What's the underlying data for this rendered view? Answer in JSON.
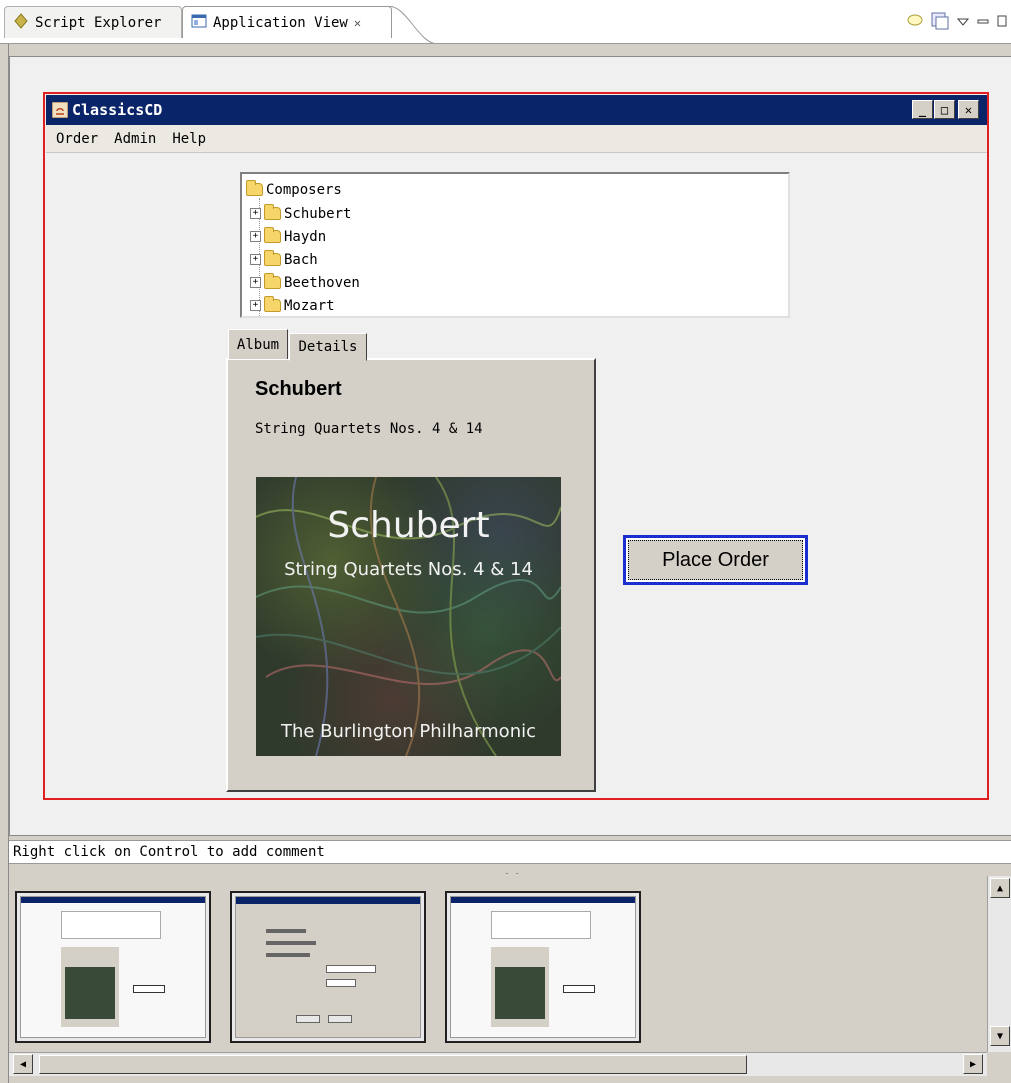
{
  "top_tabs": [
    {
      "label": "Script Explorer",
      "icon": "script-icon"
    },
    {
      "label": "Application View",
      "icon": "app-view-icon",
      "close_glyph": "✕"
    }
  ],
  "app_window": {
    "title": "ClassicsCD",
    "window_controls": [
      "_",
      "□",
      "✕"
    ],
    "menu": [
      "Order",
      "Admin",
      "Help"
    ]
  },
  "tree": {
    "root": "Composers",
    "items": [
      "Schubert",
      "Haydn",
      "Bach",
      "Beethoven",
      "Mozart"
    ]
  },
  "tabs": [
    "Album",
    "Details"
  ],
  "album": {
    "composer": "Schubert",
    "title": "String Quartets Nos. 4 & 14",
    "cover": {
      "composer": "Schubert",
      "title": "String Quartets Nos. 4 & 14",
      "orchestra": "The Burlington Philharmonic"
    }
  },
  "place_order_label": "Place Order",
  "comment_hint": "Right click on Control to add comment",
  "colors": {
    "titlebar": "#0a246a",
    "selection_outline": "#e02020",
    "focus_border": "#1a2fd0"
  }
}
